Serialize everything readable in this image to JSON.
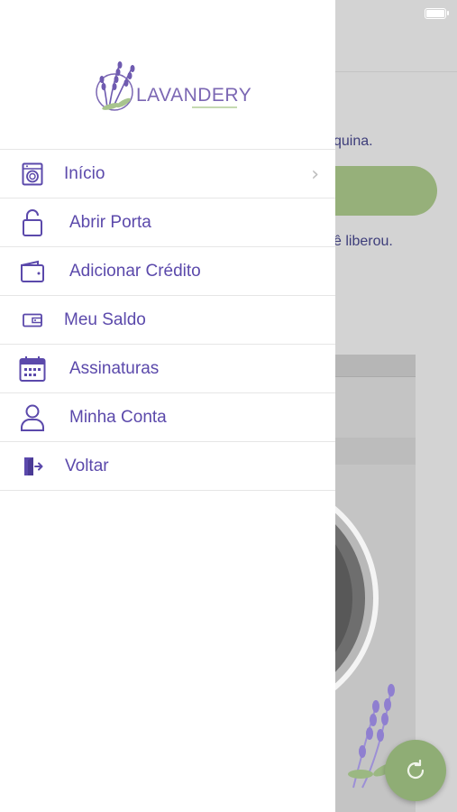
{
  "background": {
    "text_line_1": "quina.",
    "text_line_2": "ê liberou."
  },
  "drawer": {
    "logo_text": "LAVANDERY",
    "menu": [
      {
        "label": "Início",
        "icon": "washing-machine-icon"
      },
      {
        "label": "Abrir Porta",
        "icon": "unlock-icon"
      },
      {
        "label": "Adicionar Crédito",
        "icon": "wallet-icon"
      },
      {
        "label": "Meu Saldo",
        "icon": "wallet-small-icon"
      },
      {
        "label": "Assinaturas",
        "icon": "calendar-icon"
      },
      {
        "label": "Minha Conta",
        "icon": "user-icon"
      },
      {
        "label": "Voltar",
        "icon": "exit-door-icon"
      }
    ]
  },
  "colors": {
    "accent_purple": "#5b49ab",
    "accent_green": "#96b07a",
    "logo_purple": "#7b67b3"
  }
}
